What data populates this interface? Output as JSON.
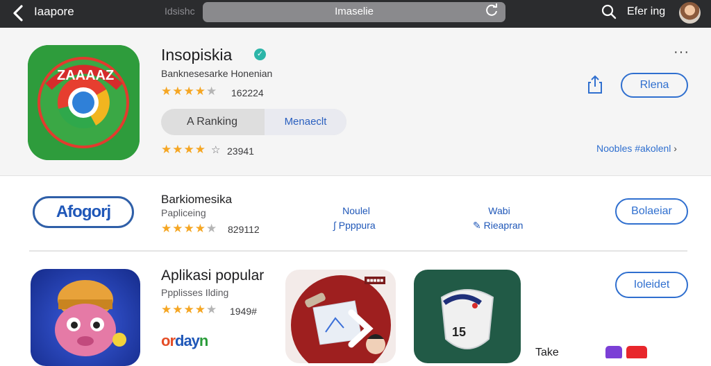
{
  "topbar": {
    "title": "Iaapore",
    "tab": "Idsishc",
    "url": "Imaselie",
    "user": "Efer ing"
  },
  "hero": {
    "app_name": "Insopiskia",
    "subtitle": "Banknesesarke Honenian",
    "rating_text": "162224",
    "rating2_text": "23941",
    "rating_stars": 3.5,
    "seg_left": "A Ranking",
    "seg_right": "Menaeclt",
    "open_label": "Rlena",
    "more_link": "Noobles #akolenl",
    "more_label": "···"
  },
  "row2": {
    "logo_text": "Afogorj",
    "title": "Barkiomesika",
    "subtitle": "Papliceing",
    "rating_text": "829112",
    "stat1_top": "Noulel",
    "stat1_bottom": "Ppppura",
    "stat2_top": "Wabi",
    "stat2_bottom": "Rieapran",
    "button_label": "Bolaeiar"
  },
  "row3": {
    "title": "Aplikasi popular",
    "subtitle": "Ppplisses Ilding",
    "rating_text": "1949#",
    "button_label": "Ioleidet",
    "brand_o": "or",
    "brand_d": "day",
    "brand_a": "n",
    "badge_text": "■■■■■",
    "thumb3_number": "15",
    "take_label": "Take"
  },
  "colors": {
    "accent": "#2f6fcf",
    "star": "#f5a623",
    "topbar": "#2b2c2e"
  }
}
